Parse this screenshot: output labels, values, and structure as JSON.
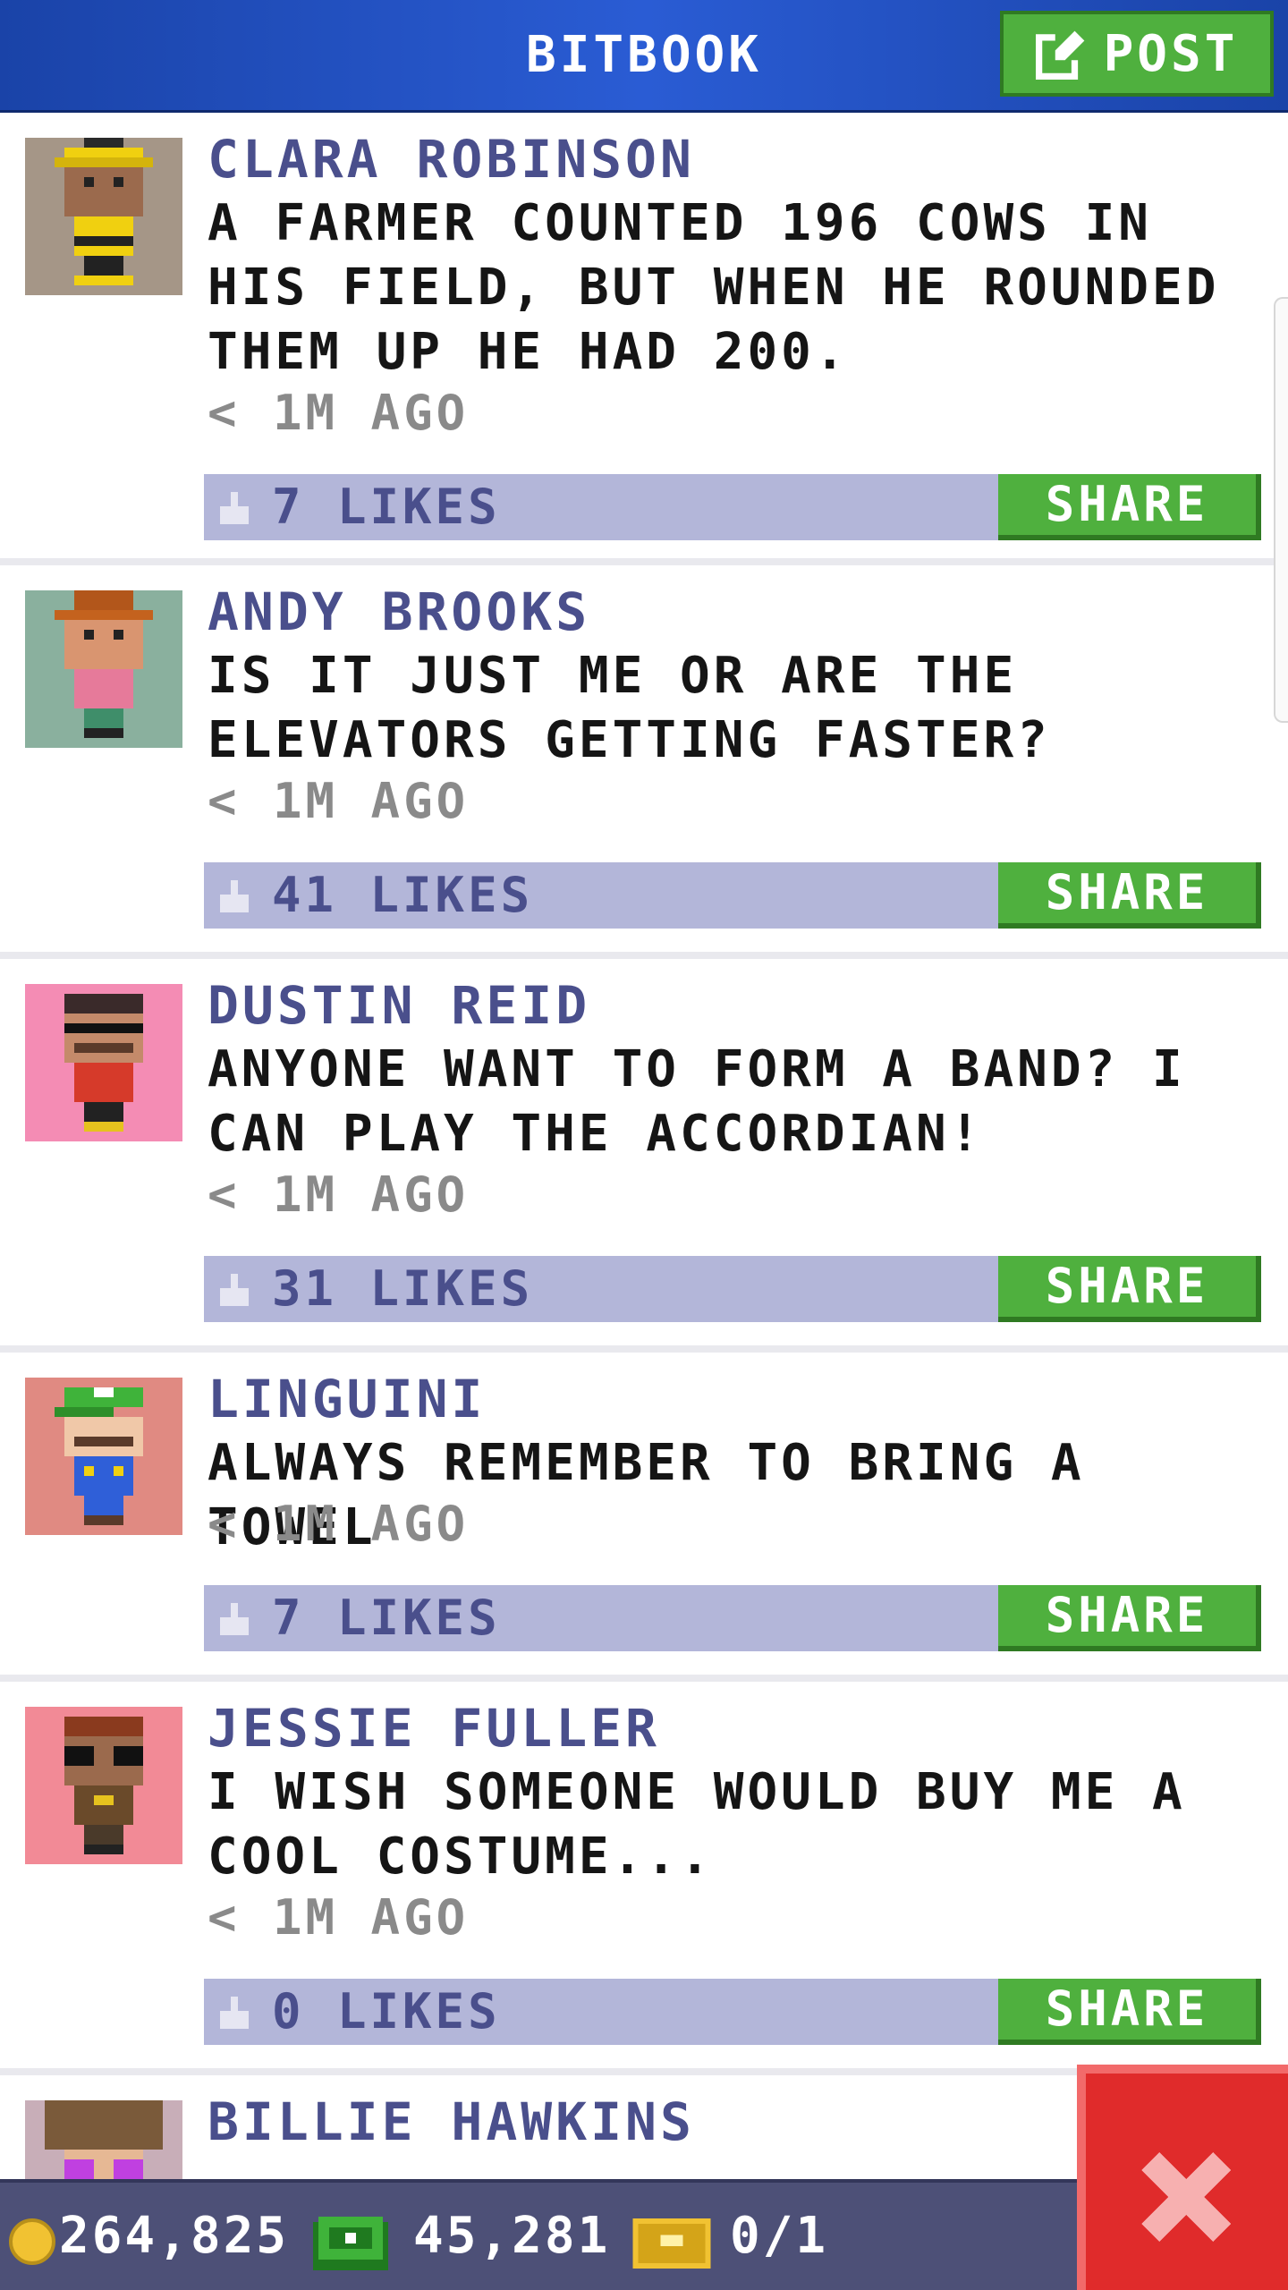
{
  "header": {
    "title": "BITBOOK",
    "post_button": {
      "label": "POST",
      "icon": "edit-icon"
    }
  },
  "colors": {
    "header_blue": "#2a5cd4",
    "name_purple": "#4a4f8c",
    "likes_bar": "#b3b6d9",
    "share_green": "#4fb03e",
    "close_red": "#e02b2b",
    "footer": "#4d5077"
  },
  "posts": [
    {
      "name": "CLARA ROBINSON",
      "text": "A FARMER COUNTED 196 COWS IN HIS FIELD, BUT WHEN HE ROUNDED THEM UP HE HAD 200.",
      "time": "< 1M AGO",
      "likes": "7 LIKES",
      "share": "SHARE"
    },
    {
      "name": "ANDY BROOKS",
      "text": "IS IT JUST ME OR ARE THE ELEVATORS GETTING FASTER?",
      "time": "< 1M AGO",
      "likes": "41 LIKES",
      "share": "SHARE"
    },
    {
      "name": "DUSTIN REID",
      "text": "ANYONE WANT TO FORM A BAND? I CAN PLAY THE ACCORDIAN!",
      "time": "< 1M AGO",
      "likes": "31 LIKES",
      "share": "SHARE"
    },
    {
      "name": "LINGUINI",
      "text": "ALWAYS REMEMBER TO BRING A TOWEL",
      "time": "< 1M AGO",
      "likes": "7 LIKES",
      "share": "SHARE"
    },
    {
      "name": "JESSIE FULLER",
      "text": "I WISH SOMEONE WOULD BUY ME A COOL COSTUME...",
      "time": "< 1M AGO",
      "likes": "0 LIKES",
      "share": "SHARE"
    },
    {
      "name": "BILLIE HAWKINS"
    }
  ],
  "footer": {
    "coins": "264,825",
    "bux": "45,281",
    "tickets": "0/1",
    "icons": [
      "coin-icon",
      "bux-icon",
      "ticket-icon"
    ]
  },
  "close_button": {
    "icon": "close-icon"
  }
}
